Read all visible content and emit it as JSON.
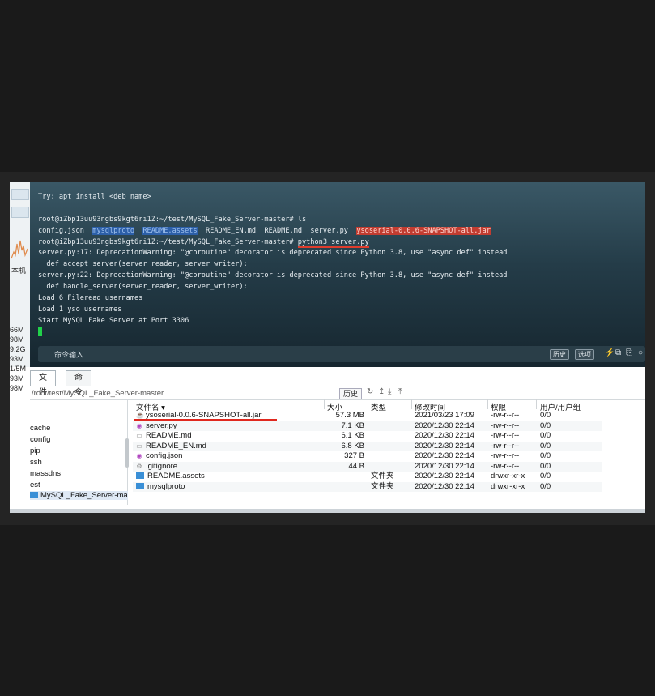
{
  "left_strip": {
    "label": "本机",
    "sizes": [
      "66M",
      "98M",
      "9.2G",
      "93M",
      "1/5M",
      "93M",
      "98M"
    ]
  },
  "terminal": {
    "lines": [
      {
        "text": "Try: apt install <deb name>"
      },
      {
        "text": ""
      },
      {
        "text": "root@iZbp13uu93ngbs9kgt6ri1Z:~/test/MySQL_Fake_Server-master# ls"
      },
      {
        "text": "config.json  "
      },
      {
        "text": "root@iZbp13uu93ngbs9kgt6ri1Z:~/test/MySQL_Fake_Server-master# "
      },
      {
        "text": "server.py:17: DeprecationWarning: \"@coroutine\" decorator is deprecated since Python 3.8, use \"async def\" instead"
      },
      {
        "text": "  def accept_server(server_reader, server_writer):"
      },
      {
        "text": "server.py:22: DeprecationWarning: \"@coroutine\" decorator is deprecated since Python 3.8, use \"async def\" instead"
      },
      {
        "text": "  def handle_server(server_reader, server_writer):"
      },
      {
        "text": "Load 6 Fileread usernames"
      },
      {
        "text": "Load 1 yso usernames"
      },
      {
        "text": "Start MySQL Fake Server at Port 3306"
      }
    ],
    "ls_items": {
      "mysqlproto": "mysqlproto",
      "readme_assets": "README.assets",
      "readme_en": "README_EN.md",
      "readme": "README.md",
      "server": "server.py",
      "jar": "ysoserial-0.0.6-SNAPSHOT-all.jar"
    },
    "command": "python3 server.py",
    "cmd_placeholder": "命令输入",
    "history_btn": "历史",
    "options_btn": "选项"
  },
  "tabs": {
    "files": "文件",
    "commands": "命令"
  },
  "path": {
    "value": "/root/test/MySQL_Fake_Server-master",
    "history_btn": "历史"
  },
  "tree": [
    "cache",
    "config",
    "pip",
    "ssh",
    "massdns",
    "est",
    "MySQL_Fake_Server-ma"
  ],
  "files": {
    "headers": {
      "name": "文件名",
      "size": "大小",
      "type": "类型",
      "modified": "修改时间",
      "perm": "权限",
      "owner": "用户/用户组"
    },
    "rows": [
      {
        "name": "ysoserial-0.0.6-SNAPSHOT-all.jar",
        "size": "57.3 MB",
        "type": "",
        "modified": "2021/03/23 17:09",
        "perm": "-rw-r--r--",
        "owner": "0/0",
        "icon": "jar"
      },
      {
        "name": "server.py",
        "size": "7.1 KB",
        "type": "",
        "modified": "2020/12/30 22:14",
        "perm": "-rw-r--r--",
        "owner": "0/0",
        "icon": "py"
      },
      {
        "name": "README.md",
        "size": "6.1 KB",
        "type": "",
        "modified": "2020/12/30 22:14",
        "perm": "-rw-r--r--",
        "owner": "0/0",
        "icon": "file"
      },
      {
        "name": "README_EN.md",
        "size": "6.8 KB",
        "type": "",
        "modified": "2020/12/30 22:14",
        "perm": "-rw-r--r--",
        "owner": "0/0",
        "icon": "file"
      },
      {
        "name": "config.json",
        "size": "327 B",
        "type": "",
        "modified": "2020/12/30 22:14",
        "perm": "-rw-r--r--",
        "owner": "0/0",
        "icon": "py"
      },
      {
        "name": ".gitignore",
        "size": "44 B",
        "type": "",
        "modified": "2020/12/30 22:14",
        "perm": "-rw-r--r--",
        "owner": "0/0",
        "icon": "gear"
      },
      {
        "name": "README.assets",
        "size": "",
        "type": "文件夹",
        "modified": "2020/12/30 22:14",
        "perm": "drwxr-xr-x",
        "owner": "0/0",
        "icon": "folder"
      },
      {
        "name": "mysqlproto",
        "size": "",
        "type": "文件夹",
        "modified": "2020/12/30 22:14",
        "perm": "drwxr-xr-x",
        "owner": "0/0",
        "icon": "folder"
      }
    ]
  }
}
